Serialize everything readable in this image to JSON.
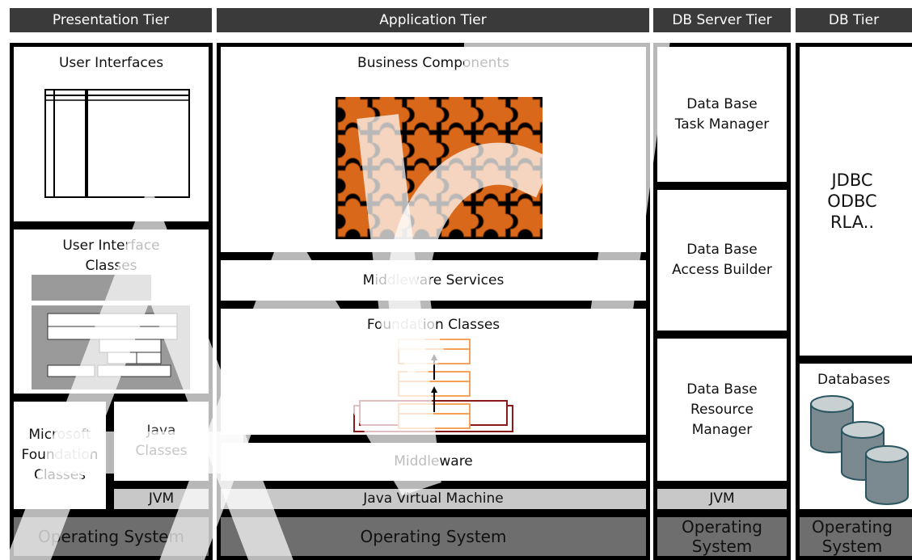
{
  "headers": [
    "Presentation Tier",
    "Application Tier",
    "DB Server Tier",
    "DB Tier"
  ],
  "presentation": {
    "user_interfaces": "User Interfaces",
    "ui_classes": "User Interface\nClasses",
    "mfc": "Microsoft\nFoundation\nClasses",
    "java_classes": "Java\nClasses",
    "jvm": "JVM",
    "os": "Operating System"
  },
  "application": {
    "business_components": "Business Components",
    "middleware_services": "Middleware Services",
    "foundation_classes": "Foundation Classes",
    "middleware": "Middleware",
    "jvm": "Java Virtual Machine",
    "os": "Operating System"
  },
  "db_server": {
    "task_manager": "Data Base\nTask Manager",
    "access_builder": "Data Base\nAccess Builder",
    "resource_manager": "Data Base\nResource\nManager",
    "jvm": "JVM",
    "os": "Operating\nSystem"
  },
  "db_tier": {
    "connectors": "JDBC\nODBC\nRLA..",
    "databases": "Databases",
    "os": "Operating\nSystem"
  },
  "colors": {
    "header_bg": "#3a3a3a",
    "puzzle": "#d9681a",
    "foundation_box": "#f5a35a",
    "middleware_stack": "#8b1a1a",
    "cylinder": "#7a8a90"
  }
}
